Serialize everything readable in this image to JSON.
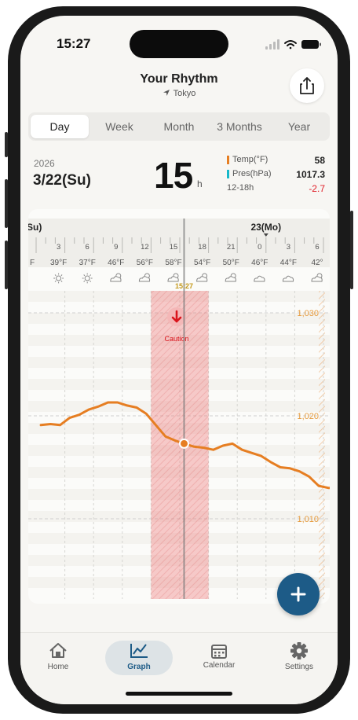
{
  "status": {
    "time": "15:27"
  },
  "header": {
    "title": "Your Rhythm",
    "location": "Tokyo"
  },
  "tabs": [
    {
      "label": "Day",
      "active": true
    },
    {
      "label": "Week",
      "active": false
    },
    {
      "label": "Month",
      "active": false
    },
    {
      "label": "3 Months",
      "active": false
    },
    {
      "label": "Year",
      "active": false
    }
  ],
  "info": {
    "year": "2026",
    "date": "3/22(Su)",
    "hour": "15",
    "hour_unit": "h",
    "temp_label": "Temp(°F)",
    "temp_value": "58",
    "pres_label": "Pres(hPa)",
    "pres_value": "1017.3",
    "range_label": "12-18h",
    "change_value": "-2.7"
  },
  "chart_data": {
    "type": "line",
    "day_labels": {
      "left": "Su)",
      "right": "23(Mo)"
    },
    "hour_ticks": [
      "3",
      "6",
      "9",
      "12",
      "15",
      "18",
      "21",
      "0",
      "3",
      "6"
    ],
    "temperatures": [
      "F",
      "39°F",
      "37°F",
      "46°F",
      "56°F",
      "58°F",
      "54°F",
      "50°F",
      "46°F",
      "44°F",
      "42°"
    ],
    "weather_icons": [
      "sun-icon",
      "sun-icon",
      "partly-cloudy-icon",
      "partly-cloudy-icon",
      "partly-cloudy-icon",
      "partly-cloudy-icon",
      "partly-cloudy-icon",
      "cloud-icon",
      "cloud-icon",
      "partly-cloudy-icon"
    ],
    "current_time": "15:27",
    "caution_label": "Caution",
    "y_ticks": [
      "1,030",
      "1,020",
      "1,010"
    ],
    "y_values": [
      1030,
      1020,
      1010
    ],
    "series": [
      {
        "values": [
          [
            0.5,
            1019.1
          ],
          [
            1.5,
            1019.2
          ],
          [
            2.5,
            1019.1
          ],
          [
            3.5,
            1019.8
          ],
          [
            4.5,
            1020.1
          ],
          [
            5.5,
            1020.6
          ],
          [
            6.5,
            1020.9
          ],
          [
            7.5,
            1021.3
          ],
          [
            8.5,
            1021.3
          ],
          [
            9.5,
            1021.0
          ],
          [
            10.5,
            1020.8
          ],
          [
            11.5,
            1020.2
          ],
          [
            12.5,
            1019.1
          ],
          [
            13.5,
            1018.0
          ],
          [
            14.5,
            1017.6
          ],
          [
            15.45,
            1017.3
          ],
          [
            16.5,
            1017.0
          ],
          [
            17.5,
            1016.9
          ],
          [
            18.5,
            1016.7
          ],
          [
            19.5,
            1017.1
          ],
          [
            20.5,
            1017.3
          ],
          [
            21.5,
            1016.7
          ],
          [
            22.5,
            1016.4
          ],
          [
            23.5,
            1016.1
          ],
          [
            24.5,
            1015.5
          ],
          [
            25.5,
            1015.0
          ],
          [
            26.5,
            1014.9
          ],
          [
            27.5,
            1014.6
          ],
          [
            28.5,
            1014.1
          ],
          [
            29.5,
            1013.2
          ],
          [
            30.5,
            1013.0
          ],
          [
            31.5,
            1013.0
          ],
          [
            32.5,
            1013.1
          ],
          [
            33.5,
            1013.3
          ]
        ],
        "color": "#e67e22"
      }
    ],
    "caution_range": [
      12,
      18
    ]
  },
  "fab": {
    "label": "+"
  },
  "tabbar": [
    {
      "label": "Home",
      "icon": "home-icon"
    },
    {
      "label": "Graph",
      "icon": "graph-icon",
      "active": true
    },
    {
      "label": "Calendar",
      "icon": "calendar-icon"
    },
    {
      "label": "Settings",
      "icon": "gear-icon"
    }
  ]
}
